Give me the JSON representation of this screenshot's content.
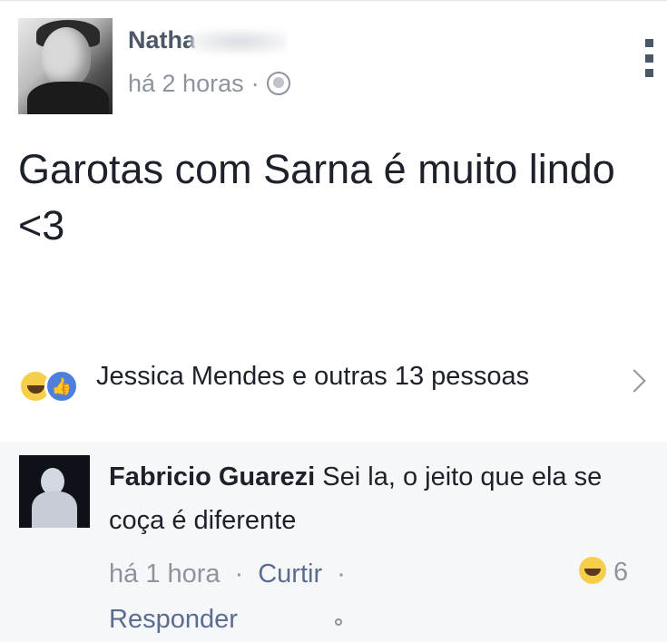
{
  "post": {
    "author_name": "Natha",
    "time": "há 2 horas",
    "separator": "·",
    "text": "Garotas com Sarna é muito lindo <3",
    "reactions_summary": "Jessica Mendes e outras 13 pessoas",
    "like_glyph": "👍"
  },
  "comment": {
    "author_name": "Fabricio Guarezi",
    "text": "Sei la, o jeito que ela se coça é diferente",
    "time": "há 1 hora",
    "like_label": "Curtir",
    "reply_label": "Responder",
    "separator": "·",
    "reaction_count": "6"
  },
  "icons": {
    "privacy": "globe-icon",
    "options": "more-vertical-icon",
    "reaction_haha": "haha-reaction-icon",
    "reaction_like": "like-reaction-icon",
    "expand": "chevron-right-icon"
  }
}
